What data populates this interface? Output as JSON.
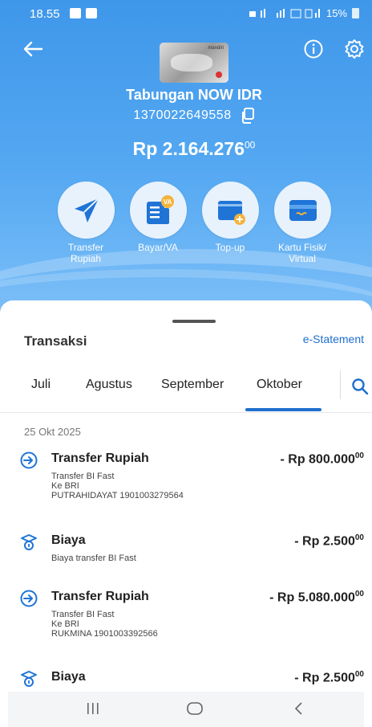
{
  "status_bar": {
    "time": "18.55",
    "right_text": "15%"
  },
  "header": {
    "account_name": "Tabungan NOW IDR",
    "account_number": "1370022649558",
    "balance_main": "Rp 2.164.276",
    "balance_cents": "00",
    "card_brand": "mandiri"
  },
  "actions": [
    {
      "label_line1": "Transfer",
      "label_line2": "Rupiah",
      "icon": "send-icon"
    },
    {
      "label_line1": "Bayar/VA",
      "label_line2": "",
      "icon": "bill-va-icon",
      "badge": "VA"
    },
    {
      "label_line1": "Top-up",
      "label_line2": "",
      "icon": "wallet-topup-icon"
    },
    {
      "label_line1": "Kartu Fisik/",
      "label_line2": "Virtual",
      "icon": "card-icon"
    }
  ],
  "transactions_section": {
    "title": "Transaksi",
    "estatement": "e-Statement",
    "tabs": [
      "Juli",
      "Agustus",
      "September",
      "Oktober"
    ],
    "active_tab": "Oktober",
    "date_header": "25 Okt 2025"
  },
  "transactions": [
    {
      "title": "Transfer Rupiah",
      "amount": "- Rp 800.000",
      "cents": "00",
      "lines": [
        "Transfer BI Fast",
        "Ke BRI",
        "PUTRAHIDAYAT 1901003279564"
      ],
      "icon": "transfer-icon"
    },
    {
      "title": "Biaya",
      "amount": "- Rp 2.500",
      "cents": "00",
      "lines": [
        "Biaya transfer BI Fast"
      ],
      "icon": "fee-icon"
    },
    {
      "title": "Transfer Rupiah",
      "amount": "- Rp 5.080.000",
      "cents": "00",
      "lines": [
        "Transfer BI Fast",
        "Ke BRI",
        "RUKMINA 1901003392566"
      ],
      "icon": "transfer-icon"
    },
    {
      "title": "Biaya",
      "amount": "- Rp 2.500",
      "cents": "00",
      "lines": [],
      "icon": "fee-icon"
    }
  ],
  "colors": {
    "primary_blue": "#3f97ea",
    "accent_blue": "#1e6fcf",
    "icon_blue": "#1f74d6",
    "badge_yellow": "#f4b33b"
  }
}
